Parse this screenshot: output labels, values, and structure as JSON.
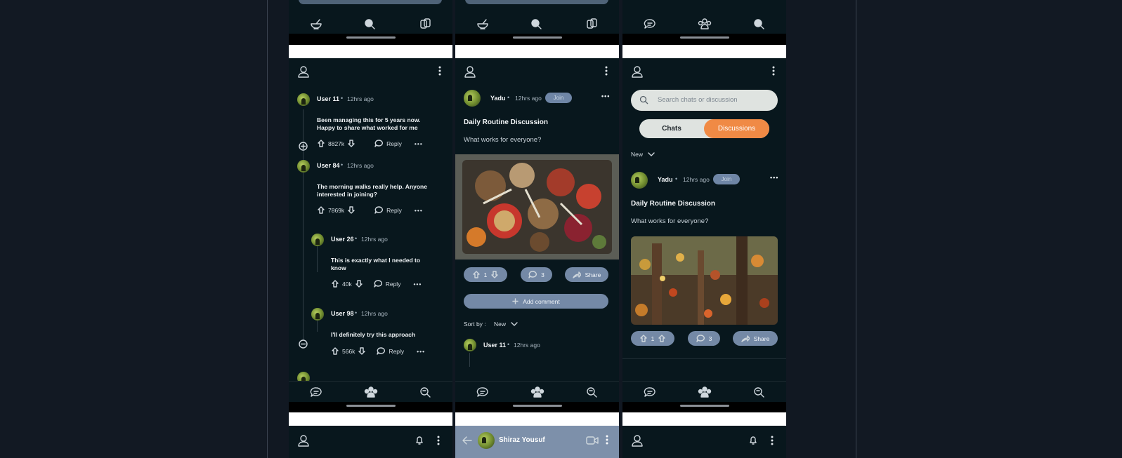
{
  "screen1": {
    "comments": [
      {
        "user": "User 11",
        "time": "12hrs ago",
        "text": [
          "Been managing this for 5 years now.",
          "Happy to share what worked for me"
        ],
        "votes": "8827k",
        "reply": "Reply"
      },
      {
        "user": "User 84",
        "time": "12hrs ago",
        "text": [
          "The morning walks really help. Anyone",
          "interested in joining?"
        ],
        "votes": "7869k",
        "reply": "Reply"
      },
      {
        "user": "User 26",
        "time": "12hrs ago",
        "text": [
          "This is exactly what I needed to",
          "know"
        ],
        "votes": "40k",
        "reply": "Reply"
      },
      {
        "user": "User 98",
        "time": "12hrs ago",
        "text": [
          "I'll definitely try this approach",
          ""
        ],
        "votes": "566k",
        "reply": "Reply"
      }
    ]
  },
  "screen2": {
    "post": {
      "user": "Yadu",
      "time": "12hrs ago",
      "join": "Join",
      "title": "Daily Routine Discussion",
      "subtitle": "What works for everyone?",
      "upvotes": "1",
      "comments": "3",
      "share": "Share"
    },
    "add_comment": "Add comment",
    "sort_label": "Sort by :",
    "sort_value": "New",
    "first_comment": {
      "user": "User 11",
      "time": "12hrs ago"
    },
    "next_screen_title": "Shiraz Yousuf"
  },
  "screen3": {
    "search_placeholder": "Search chats or discussion",
    "tab_chats": "Chats",
    "tab_discussions": "Discussions",
    "filter": "New",
    "post": {
      "user": "Yadu",
      "time": "12hrs ago",
      "join": "Join",
      "title": "Daily Routine Discussion",
      "subtitle": "What works for everyone?",
      "upvotes": "1",
      "comments": "3",
      "share": "Share"
    }
  },
  "colors": {
    "background": "#08171d",
    "accent": "#f08a45",
    "button": "#7489a6"
  }
}
